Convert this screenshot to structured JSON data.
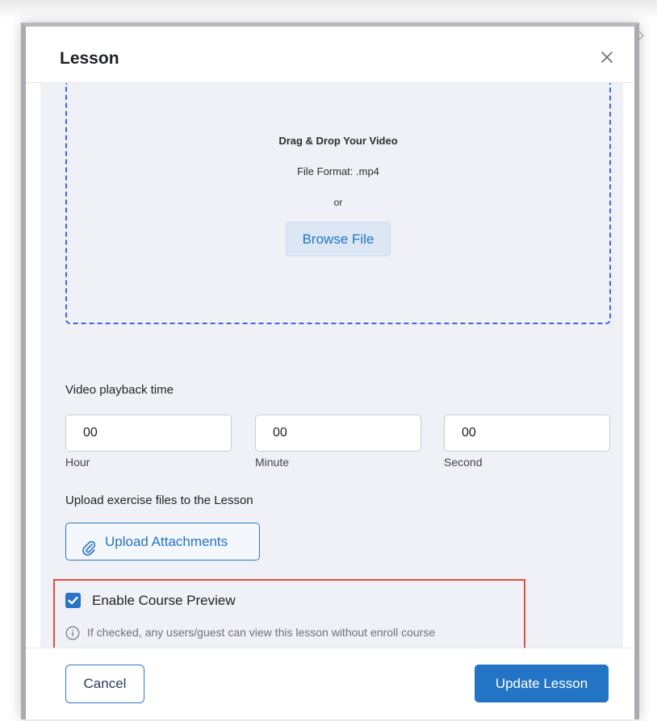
{
  "modal": {
    "title": "Lesson"
  },
  "dropzone": {
    "title": "Drag & Drop Your Video",
    "format": "File Format: .mp4",
    "or": "or",
    "browse_label": "Browse File"
  },
  "playback": {
    "label": "Video playback time",
    "fields": [
      {
        "value": "00",
        "caption": "Hour"
      },
      {
        "value": "00",
        "caption": "Minute"
      },
      {
        "value": "00",
        "caption": "Second"
      }
    ]
  },
  "attachments": {
    "label": "Upload exercise files to the Lesson",
    "button_label": "Upload Attachments"
  },
  "preview": {
    "checked": true,
    "label": "Enable Course Preview",
    "info": "If checked, any users/guest can view this lesson without enroll course"
  },
  "footer": {
    "cancel_label": "Cancel",
    "update_label": "Update Lesson"
  },
  "colors": {
    "accent": "#2374c4",
    "highlight": "#e34d3c",
    "dropzone_border": "#3e64de"
  },
  "icons": {
    "close": "close-icon",
    "attachment": "paperclip-icon",
    "checkbox": "checkmark-icon",
    "info": "info-icon"
  }
}
